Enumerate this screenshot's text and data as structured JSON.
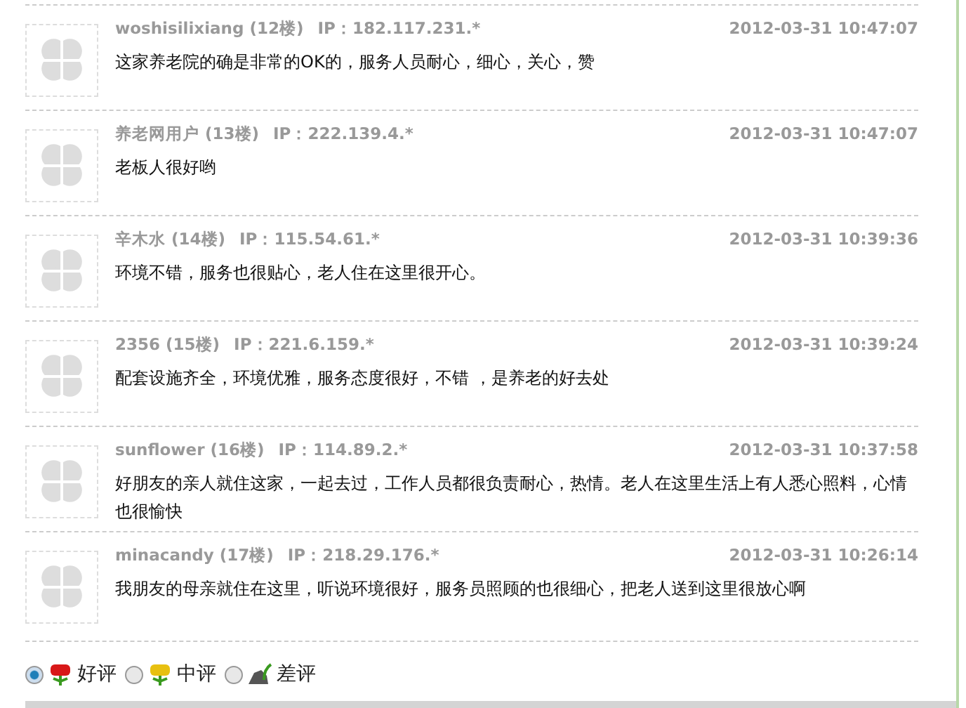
{
  "comments": [
    {
      "user": "woshisilixiang",
      "floor": "(12楼)",
      "ip": "IP：182.117.231.*",
      "time": "2012-03-31 10:47:07",
      "text": "这家养老院的确是非常的OK的，服务人员耐心，细心，关心，赞"
    },
    {
      "user": "养老网用户",
      "floor": "(13楼)",
      "ip": "IP：222.139.4.*",
      "time": "2012-03-31 10:47:07",
      "text": "老板人很好哟"
    },
    {
      "user": "辛木水",
      "floor": "(14楼)",
      "ip": "IP：115.54.61.*",
      "time": "2012-03-31 10:39:36",
      "text": "环境不错，服务也很贴心，老人住在这里很开心。"
    },
    {
      "user": "2356",
      "floor": "(15楼)",
      "ip": "IP：221.6.159.*",
      "time": "2012-03-31 10:39:24",
      "text": "配套设施齐全，环境优雅，服务态度很好，不错 ，是养老的好去处"
    },
    {
      "user": "sunflower",
      "floor": "(16楼)",
      "ip": "IP：114.89.2.*",
      "time": "2012-03-31 10:37:58",
      "text": "好朋友的亲人就住这家，一起去过，工作人员都很负责耐心，热情。老人在这里生活上有人悉心照料，心情也很愉快"
    },
    {
      "user": "minacandy",
      "floor": "(17楼)",
      "ip": "IP：218.29.176.*",
      "time": "2012-03-31 10:26:14",
      "text": "我朋友的母亲就住在这里，听说环境很好，服务员照顾的也很细心，把老人送到这里很放心啊"
    }
  ],
  "ratings": [
    {
      "kind": "good",
      "label": "好评",
      "selected": true
    },
    {
      "kind": "neutral",
      "label": "中评",
      "selected": false
    },
    {
      "kind": "bad",
      "label": "差评",
      "selected": false
    }
  ]
}
